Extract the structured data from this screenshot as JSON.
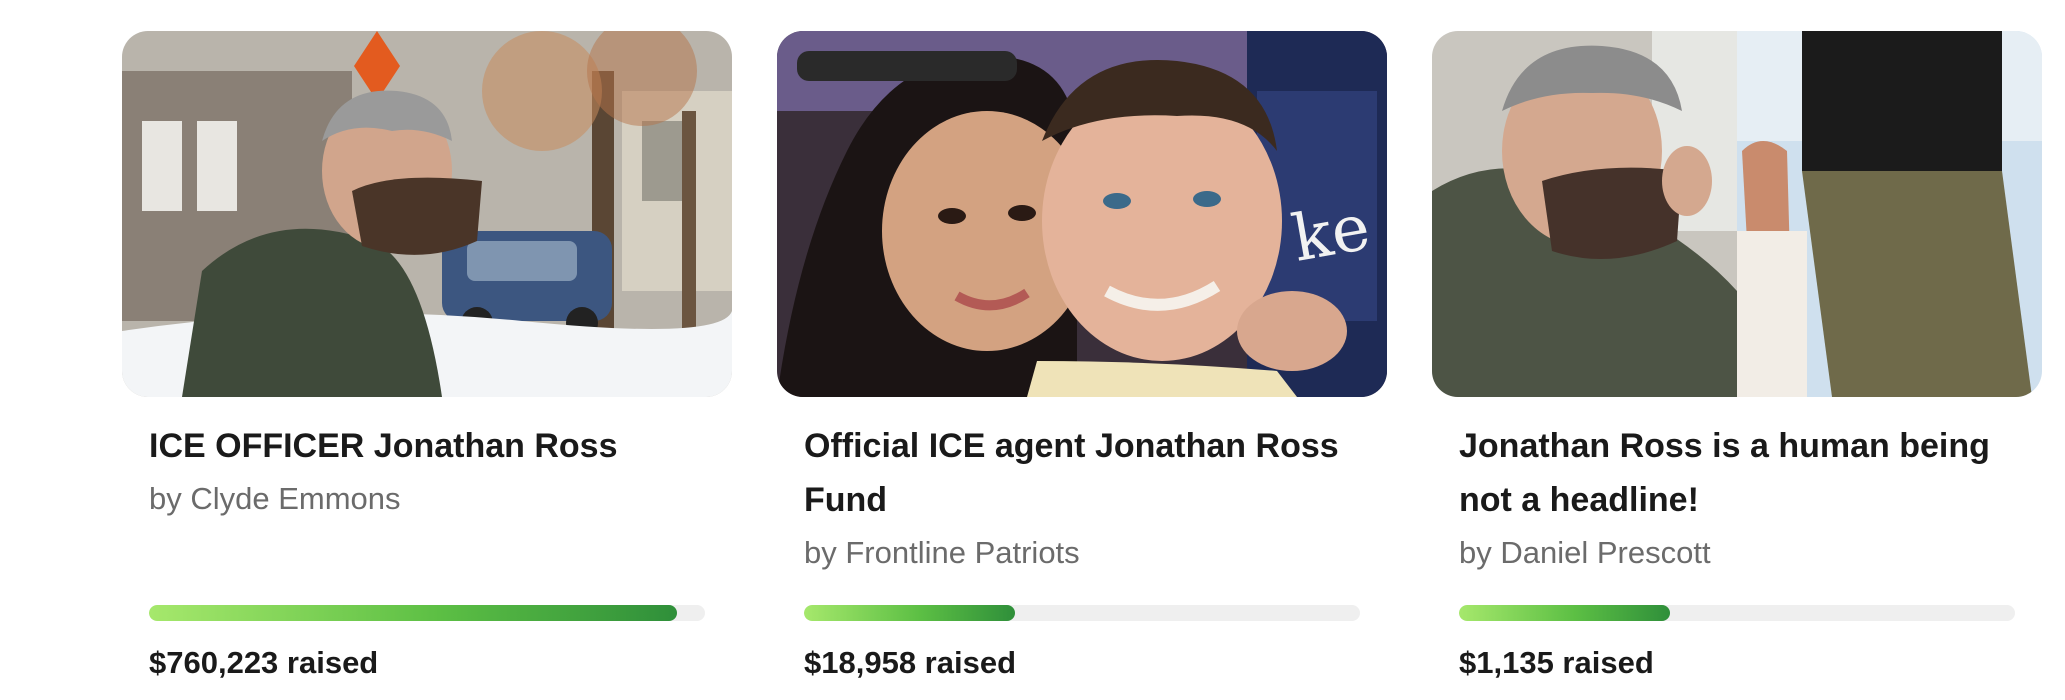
{
  "cards": [
    {
      "title": "ICE OFFICER Jonathan Ross",
      "author": "by Clyde Emmons",
      "raised": "$760,223 raised",
      "progress_fraction": 0.95
    },
    {
      "title": "Official ICE agent Jonathan Ross Fund",
      "author": "by Frontline Patriots",
      "raised": "$18,958 raised",
      "progress_fraction": 0.38
    },
    {
      "title": "Jonathan Ross is a human being not a headline!",
      "author": "by Daniel Prescott",
      "raised": "$1,135 raised",
      "progress_fraction": 0.38
    }
  ],
  "colors": {
    "progress_start": "#a6e86c",
    "progress_end": "#2f8f3a",
    "track": "#efefef"
  }
}
